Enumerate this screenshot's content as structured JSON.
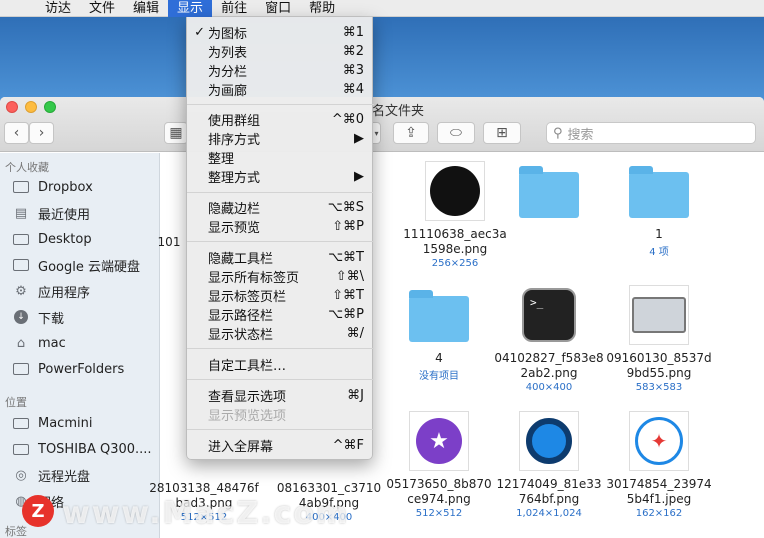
{
  "menubar": {
    "items": [
      "访达",
      "文件",
      "编辑",
      "显示",
      "前往",
      "窗口",
      "帮助"
    ],
    "active": "显示"
  },
  "window": {
    "title": "名文件夹",
    "search_placeholder": "搜索"
  },
  "sidebar": {
    "favorites_header": "个人收藏",
    "favorites": [
      {
        "label": "Dropbox",
        "icon": "folder-icon"
      },
      {
        "label": "最近使用",
        "icon": "recents-icon"
      },
      {
        "label": "Desktop",
        "icon": "desktop-icon"
      },
      {
        "label": "Google 云端硬盘",
        "icon": "folder-icon"
      },
      {
        "label": "应用程序",
        "icon": "applications-icon"
      },
      {
        "label": "下载",
        "icon": "downloads-icon"
      },
      {
        "label": "mac",
        "icon": "home-icon"
      },
      {
        "label": "PowerFolders",
        "icon": "folder-icon"
      }
    ],
    "devices_header": "位置",
    "devices": [
      {
        "label": "Macmini",
        "icon": "computer-icon"
      },
      {
        "label": "TOSHIBA Q300....",
        "icon": "disk-icon"
      },
      {
        "label": "远程光盘",
        "icon": "disc-icon"
      },
      {
        "label": "网络",
        "icon": "network-icon"
      }
    ],
    "tags_header": "标签"
  },
  "files": [
    {
      "name": "101",
      "sub": ""
    },
    {
      "name": "11110638_aec3a1598e.png",
      "sub": "256×256"
    },
    {
      "name": "",
      "sub": ""
    },
    {
      "name": "1",
      "sub": "4 项"
    },
    {
      "name": "4",
      "sub": "没有项目"
    },
    {
      "name": "04102827_f583e82ab2.png",
      "sub": "400×400"
    },
    {
      "name": "09160130_8537d9bd55.png",
      "sub": "583×583"
    },
    {
      "name": "28103138_48476fbad3.png",
      "sub": "512×512"
    },
    {
      "name": "08163301_c37104ab9f.png",
      "sub": "400×400"
    },
    {
      "name": "05173650_8b870ce974.png",
      "sub": "512×512"
    },
    {
      "name": "12174049_81e33764bf.png",
      "sub": "1,024×1,024"
    },
    {
      "name": "30174854_239745b4f1.jpeg",
      "sub": "162×162"
    }
  ],
  "view_menu": {
    "items": [
      {
        "label": "为图标",
        "shortcut": "⌘1",
        "checked": "✓"
      },
      {
        "label": "为列表",
        "shortcut": "⌘2",
        "checked": ""
      },
      {
        "label": "为分栏",
        "shortcut": "⌘3",
        "checked": ""
      },
      {
        "label": "为画廊",
        "shortcut": "⌘4",
        "checked": ""
      },
      {
        "label": "使用群组",
        "shortcut": "^⌘0",
        "checked": ""
      },
      {
        "label": "排序方式",
        "shortcut": "▶",
        "checked": ""
      },
      {
        "label": "整理",
        "shortcut": "",
        "checked": ""
      },
      {
        "label": "整理方式",
        "shortcut": "▶",
        "checked": ""
      },
      {
        "label": "隐藏边栏",
        "shortcut": "⌥⌘S",
        "checked": ""
      },
      {
        "label": "显示预览",
        "shortcut": "⇧⌘P",
        "checked": ""
      },
      {
        "label": "隐藏工具栏",
        "shortcut": "⌥⌘T",
        "checked": ""
      },
      {
        "label": "显示所有标签页",
        "shortcut": "⇧⌘\\",
        "checked": ""
      },
      {
        "label": "显示标签页栏",
        "shortcut": "⇧⌘T",
        "checked": ""
      },
      {
        "label": "显示路径栏",
        "shortcut": "⌥⌘P",
        "checked": ""
      },
      {
        "label": "显示状态栏",
        "shortcut": "⌘/",
        "checked": ""
      },
      {
        "label": "自定工具栏…",
        "shortcut": "",
        "checked": ""
      },
      {
        "label": "查看显示选项",
        "shortcut": "⌘J",
        "checked": ""
      },
      {
        "label": "显示预览选项",
        "shortcut": "",
        "checked": ""
      },
      {
        "label": "进入全屏幕",
        "shortcut": "^⌘F",
        "checked": ""
      }
    ]
  },
  "watermark": {
    "badge": "Z",
    "text": "www.MacZ.com"
  }
}
